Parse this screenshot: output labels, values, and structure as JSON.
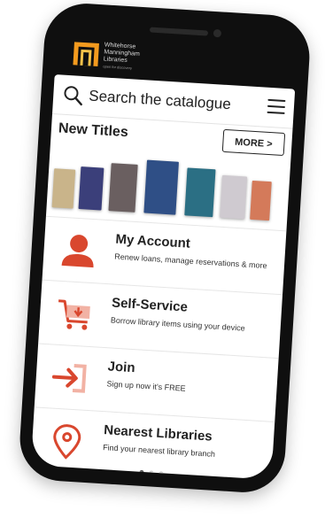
{
  "logo": {
    "name_line1": "Whitehorse",
    "name_line2": "Manningham",
    "name_line3": "Libraries",
    "tagline": "open for discovery"
  },
  "search": {
    "placeholder": "Search the catalogue"
  },
  "new_titles": {
    "heading": "New Titles",
    "more_label": "MORE >",
    "covers": [
      {
        "color": "#c9b48a"
      },
      {
        "color": "#3b3f7a"
      },
      {
        "color": "#6a5f60"
      },
      {
        "color": "#2f4f86"
      },
      {
        "color": "#2b6f84"
      },
      {
        "color": "#cfcad0"
      },
      {
        "color": "#d47a5a"
      }
    ]
  },
  "menu": [
    {
      "title": "My Account",
      "subtitle": "Renew loans, manage reservations & more",
      "icon": "person-icon"
    },
    {
      "title": "Self-Service",
      "subtitle": "Borrow library items using your device",
      "icon": "cart-icon"
    },
    {
      "title": "Join",
      "subtitle": "Sign up now it's FREE",
      "icon": "sign-in-icon"
    },
    {
      "title": "Nearest Libraries",
      "subtitle": "Find your nearest library branch",
      "icon": "location-pin-icon"
    }
  ],
  "pagination": {
    "active_index": 0,
    "count": 3
  },
  "colors": {
    "accent": "#d9472e",
    "phone_body": "#0f0f0f",
    "logo_orange": "#f39a1e"
  }
}
